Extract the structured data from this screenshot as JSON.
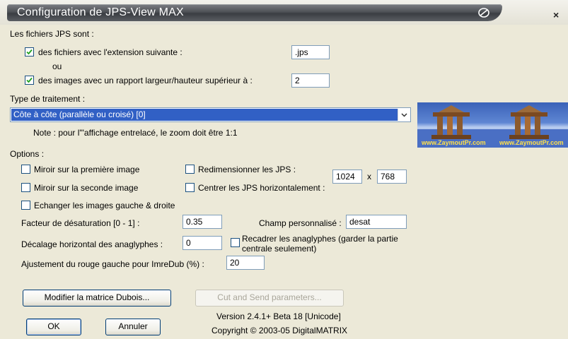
{
  "window": {
    "title": "Configuration de JPS-View MAX",
    "close_label": "×"
  },
  "files": {
    "heading": "Les fichiers JPS sont :",
    "ext_checkbox_label": "des fichiers avec l'extension suivante :",
    "ext_checked": true,
    "ext_value": ".jps",
    "or_label": "ou",
    "ratio_checkbox_label": "des images avec un rapport largeur/hauteur supérieur à :",
    "ratio_checked": true,
    "ratio_value": "2"
  },
  "processing": {
    "label": "Type de traitement :",
    "selected": "Côte à côte (parallèle ou croisé) [0]",
    "note": "Note : pour l'\"affichage entrelacé, le zoom doit être 1:1",
    "preview_text": "www.ZaymoutPr.com"
  },
  "options": {
    "heading": "Options :",
    "mirror_first": "Miroir sur la première image",
    "mirror_first_checked": false,
    "mirror_second": "Miroir sur la seconde image",
    "mirror_second_checked": false,
    "swap": "Echanger les images gauche & droite",
    "swap_checked": false,
    "resize": "Redimensionner les JPS :",
    "resize_checked": false,
    "center": "Centrer les JPS horizontalement :",
    "center_checked": false,
    "width_value": "1024",
    "times": "x",
    "height_value": "768",
    "desat_label": "Facteur de désaturation [0 - 1] :",
    "desat_value": "0.35",
    "custom_label": "Champ personnalisé :",
    "custom_value": "desat",
    "offset_label": "Décalage horizontal des anaglyphes :",
    "offset_value": "0",
    "crop_label_line1": "Recadrer les anaglyphes (garder la partie",
    "crop_label_line2": "centrale seulement)",
    "crop_checked": false,
    "red_label": "Ajustement du rouge gauche pour ImreDub (%) :",
    "red_value": "20"
  },
  "buttons": {
    "dubois": "Modifier la matrice Dubois...",
    "cut_send": "Cut and Send parameters...",
    "ok": "OK",
    "cancel": "Annuler"
  },
  "footer": {
    "version": "Version 2.4.1+ Beta 18 [Unicode]",
    "copyright": "Copyright © 2003-05 DigitalMATRIX"
  },
  "colors": {
    "title_bar": "#4f5257",
    "selection": "#3160c5",
    "dialog_bg": "#ece9d8"
  }
}
